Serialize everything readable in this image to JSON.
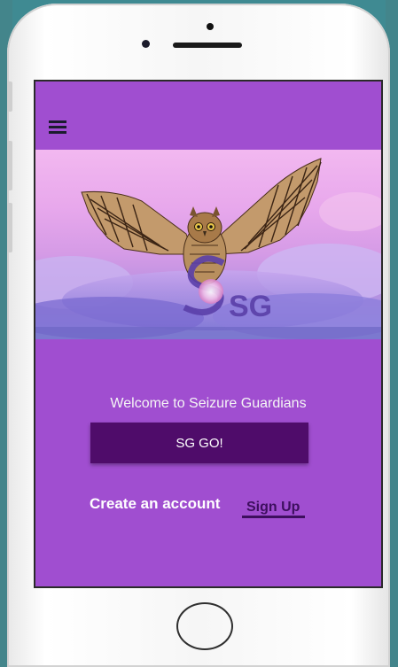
{
  "hero": {
    "brand_mark": "SG"
  },
  "welcome_text": "Welcome to Seizure Guardians",
  "go_button": "SG GO!",
  "create_account_text": "Create an account",
  "signup_link": "Sign Up",
  "colors": {
    "screen_background": "#a04ed0",
    "primary_button": "#4f0c6a",
    "link": "#3d0f5e",
    "app_bar_icon": "#1b1b2e"
  },
  "icons": {
    "menu": "hamburger-menu-icon",
    "home": "home-button"
  }
}
